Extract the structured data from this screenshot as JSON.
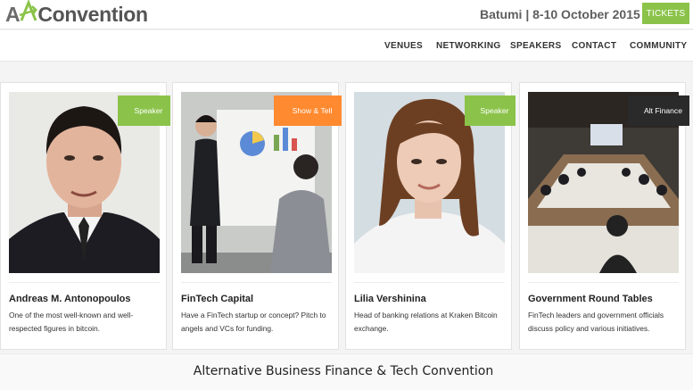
{
  "header": {
    "logo_prefix": "A",
    "logo_mid": "lt",
    "logo_rest": "Convention",
    "event_info": "Batumi | 8-10 October 2015",
    "tickets_label": "TICKETS"
  },
  "nav": {
    "items": [
      "VENUES",
      "NETWORKING",
      "SPEAKERS",
      "CONTACT",
      "COMMUNITY"
    ]
  },
  "cards": [
    {
      "tag": "Speaker",
      "tag_color": "#8bc34a",
      "title": "Andreas M. Antonopoulos",
      "desc": "One of the most well-known and well-respected figures in bitcoin."
    },
    {
      "tag": "Show & Tell",
      "tag_color": "#ff8a30",
      "title": "FinTech Capital",
      "desc": "Have a FinTech startup or concept? Pitch to angels and VCs for funding."
    },
    {
      "tag": "Speaker",
      "tag_color": "#8bc34a",
      "title": "Lilia Vershinina",
      "desc": "Head of banking relations at Kraken Bitcoin exchange."
    },
    {
      "tag": "Alt Finance",
      "tag_color": "#2a2a2a",
      "title": "Government Round Tables",
      "desc": "FinTech leaders and government officials discuss policy and various initiatives."
    }
  ],
  "footer": {
    "tagline": "Alternative Business Finance & Tech Convention"
  },
  "colors": {
    "accent_green": "#8bc34a",
    "accent_orange": "#ff8a30",
    "dark": "#2a2a2a"
  }
}
